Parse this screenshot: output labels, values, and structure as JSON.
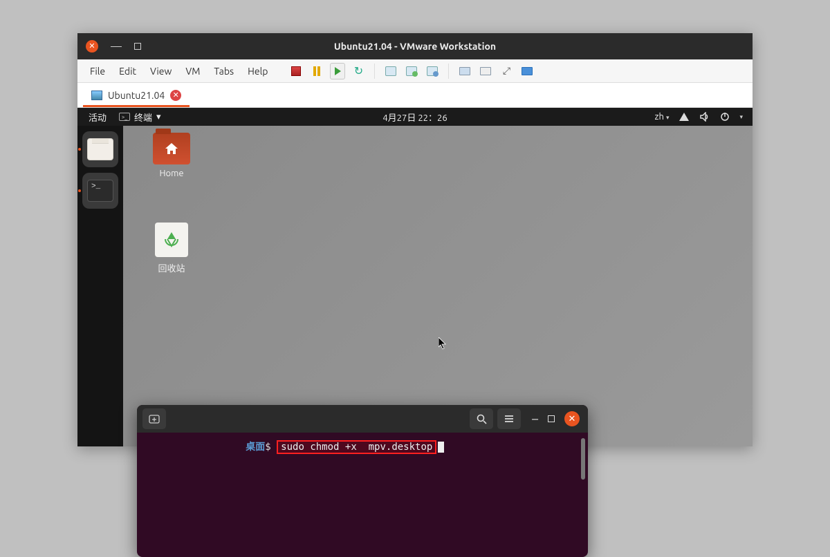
{
  "window": {
    "title": "Ubuntu21.04 - VMware Workstation"
  },
  "menubar": {
    "items": [
      "File",
      "Edit",
      "View",
      "VM",
      "Tabs",
      "Help"
    ]
  },
  "tab": {
    "label": "Ubuntu21.04"
  },
  "gnome": {
    "activities": "活动",
    "appmenu": "终端",
    "clock": "4月27日  22：26",
    "lang": "zh"
  },
  "desktop": {
    "home": "Home",
    "trash": "回收站"
  },
  "terminal": {
    "prompt_path": "桌面",
    "prompt_symbol": "$",
    "command": "sudo chmod +x  mpv.desktop"
  }
}
